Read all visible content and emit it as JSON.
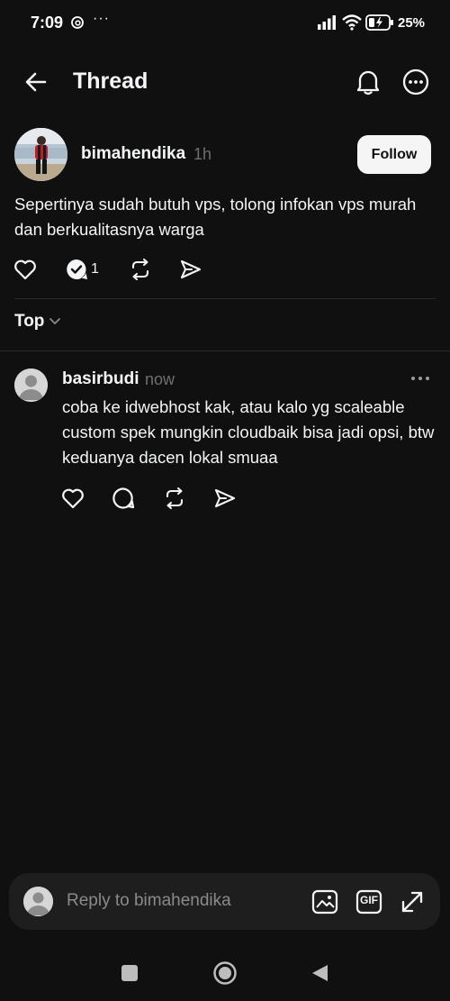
{
  "status_bar": {
    "time": "7:09",
    "more": "···",
    "battery": "25%"
  },
  "header": {
    "title": "Thread"
  },
  "post": {
    "username": "bimahendika",
    "time": "1h",
    "follow_label": "Follow",
    "text": "Sepertinya sudah butuh vps, tolong infokan vps murah dan berkualitasnya warga",
    "reply_count": "1"
  },
  "sort": {
    "label": "Top"
  },
  "reply": {
    "username": "basirbudi",
    "time": "now",
    "text": "coba ke idwebhost kak, atau kalo yg scaleable custom spek mungkin cloudbaik bisa jadi opsi, btw keduanya dacen lokal smuaa"
  },
  "composer": {
    "placeholder": "Reply to bimahendika",
    "gif_label": "GIF"
  },
  "icons": {
    "status": [
      "threads-icon",
      "signal-icon",
      "wifi-icon",
      "battery-icon"
    ],
    "header": [
      "back-arrow-icon",
      "bell-icon",
      "more-circle-icon"
    ],
    "actions": [
      "heart-icon",
      "comment-icon",
      "repost-icon",
      "share-icon"
    ],
    "composer": [
      "image-icon",
      "gif-icon",
      "expand-icon"
    ],
    "nav": [
      "recents-icon",
      "home-icon",
      "back-icon"
    ]
  },
  "colors": {
    "background": "#101010",
    "text": "#f3f5f7",
    "muted": "#6f6f6f",
    "composer_bg": "#1e1e1e",
    "follow_bg": "#f5f5f5"
  }
}
